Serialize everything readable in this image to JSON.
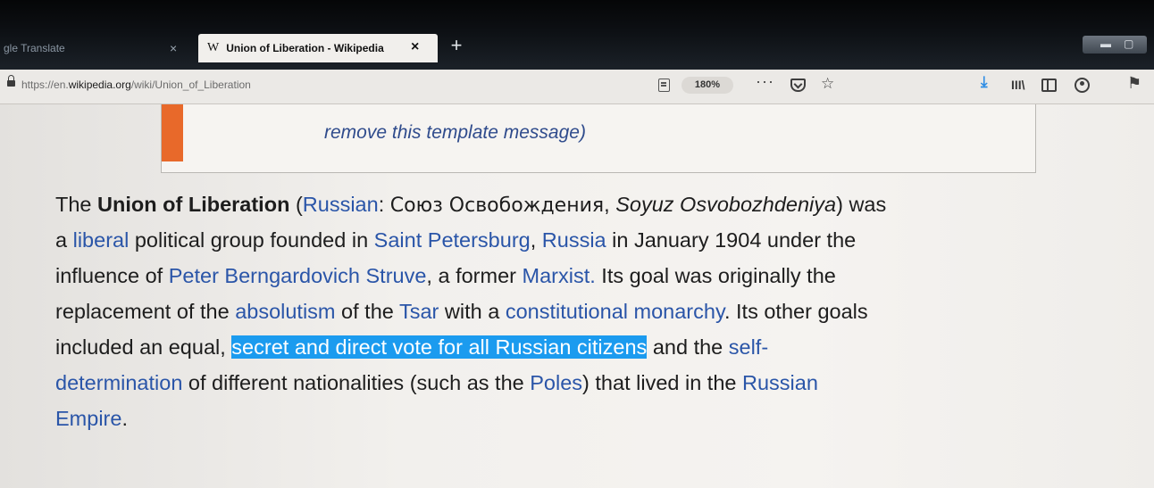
{
  "browser": {
    "tabs": [
      {
        "title": "gle Translate",
        "close": "×"
      },
      {
        "icon": "W",
        "title": "Union of Liberation - Wikipedia",
        "close": "×"
      }
    ],
    "new_tab": "+",
    "url_host_prefix": "https://en.",
    "url_host": "wikipedia.org",
    "url_path": "/wiki/Union_of_Liberation",
    "zoom": "180%",
    "more_actions": "···",
    "bookmark_star": "☆",
    "download": "⤓",
    "library": "III\\",
    "extension": "⚑"
  },
  "notice": {
    "remove_link": "remove this template message)"
  },
  "article": {
    "l1": {
      "t1": "The ",
      "b1": "Union of Liberation",
      "t2": " (",
      "a1": "Russian",
      "t3": ": ",
      "cyr": "Союз Освобождения",
      "t4": ", ",
      "i1": "Soyuz Osvobozhdeniya",
      "t5": ") was"
    },
    "l2": {
      "t1": "a ",
      "a1": "liberal",
      "t2": " political group founded in ",
      "a2": "Saint Petersburg",
      "t3": ", ",
      "a3": "Russia",
      "t4": " in January 1904 under the"
    },
    "l3": {
      "t1": "influence of ",
      "a1": "Peter Berngardovich Struve",
      "t2": ", a former ",
      "a2": "Marxist.",
      "t3": " Its goal was originally the"
    },
    "l4": {
      "t1": "replacement of the ",
      "a1": "absolutism",
      "t2": " of the ",
      "a2": "Tsar",
      "t3": " with a ",
      "a3": "constitutional monarchy",
      "t4": ". Its other goals"
    },
    "l5": {
      "t1": "included an equal, ",
      "sel": "secret and direct vote for all Russian citizens",
      "t2": " and the ",
      "a1": "self-"
    },
    "l6": {
      "a1": "determination",
      "t1": " of different nationalities (such as the ",
      "a2": "Poles",
      "t2": ") that lived in the ",
      "a3": "Russian"
    },
    "l7": {
      "a1": "Empire",
      "t1": "."
    }
  },
  "colors": {
    "link": "#2a55a8",
    "selection": "#1b9bef",
    "notice_stripe": "#e8692a",
    "download_icon": "#2f8de4"
  }
}
